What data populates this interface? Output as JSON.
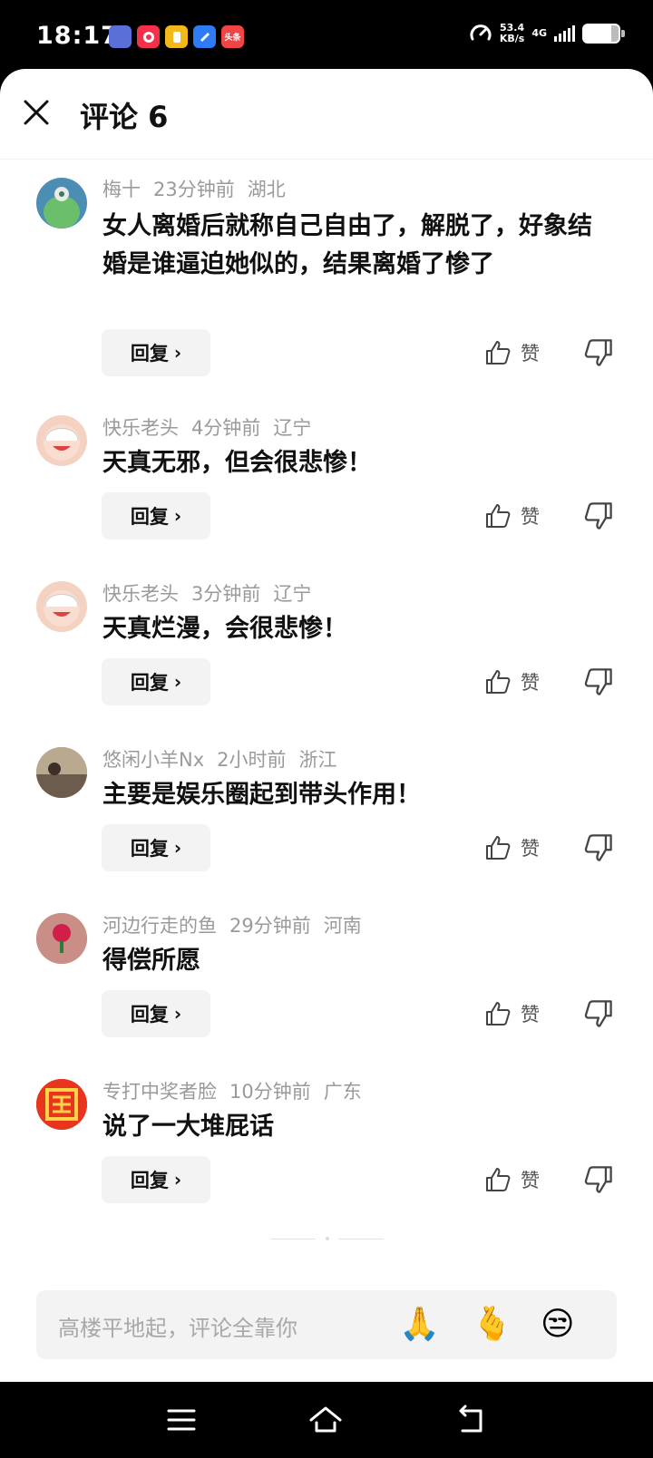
{
  "status_bar": {
    "time": "18:17",
    "speed_value": "53.4",
    "speed_unit": "KB/s",
    "network": "4G",
    "app_icons": [
      {
        "name": "game-app-icon",
        "color": "#5a6fd8",
        "label": ""
      },
      {
        "name": "red-app-icon",
        "color": "#f5304a",
        "label": ""
      },
      {
        "name": "yellow-app-icon",
        "color": "#f3b91b",
        "label": ""
      },
      {
        "name": "blue-app-icon",
        "color": "#2d7cf6",
        "label": ""
      },
      {
        "name": "toutiao-app-icon",
        "color": "#f14545",
        "label": "头条"
      }
    ]
  },
  "header": {
    "title": "评论 6"
  },
  "comments": [
    {
      "user": "梅十",
      "time": "23分钟前",
      "location": "湖北",
      "text": "女人离婚后就称自己自由了，解脱了，好象结婚是谁逼迫她似的，结果离婚了惨了",
      "reply_label": "回复",
      "like_label": "赞",
      "avatar_color": "#4c8eb3"
    },
    {
      "user": "快乐老头",
      "time": "4分钟前",
      "location": "辽宁",
      "text": "天真无邪，但会很悲惨！",
      "reply_label": "回复",
      "like_label": "赞",
      "avatar_color": "#f4d2c2"
    },
    {
      "user": "快乐老头",
      "time": "3分钟前",
      "location": "辽宁",
      "text": "天真烂漫，会很悲惨！",
      "reply_label": "回复",
      "like_label": "赞",
      "avatar_color": "#f4d2c2"
    },
    {
      "user": "悠闲小羊Nx",
      "time": "2小时前",
      "location": "浙江",
      "text": "主要是娱乐圈起到带头作用！",
      "reply_label": "回复",
      "like_label": "赞",
      "avatar_color": "#8a7a6a"
    },
    {
      "user": "河边行走的鱼",
      "time": "29分钟前",
      "location": "河南",
      "text": "得偿所愿",
      "reply_label": "回复",
      "like_label": "赞",
      "avatar_color": "#c88c84"
    },
    {
      "user": "专打中奖者脸",
      "time": "10分钟前",
      "location": "广东",
      "text": "说了一大堆屁话",
      "reply_label": "回复",
      "like_label": "赞",
      "avatar_color": "#e8361e"
    }
  ],
  "input": {
    "placeholder": "高楼平地起，评论全靠你",
    "emojis": [
      "🙏",
      "🫰",
      "😒"
    ]
  },
  "colors": {
    "meta_text": "#9a9a9a",
    "reply_bg": "#f3f3f3",
    "input_bg": "#f3f3f3"
  }
}
